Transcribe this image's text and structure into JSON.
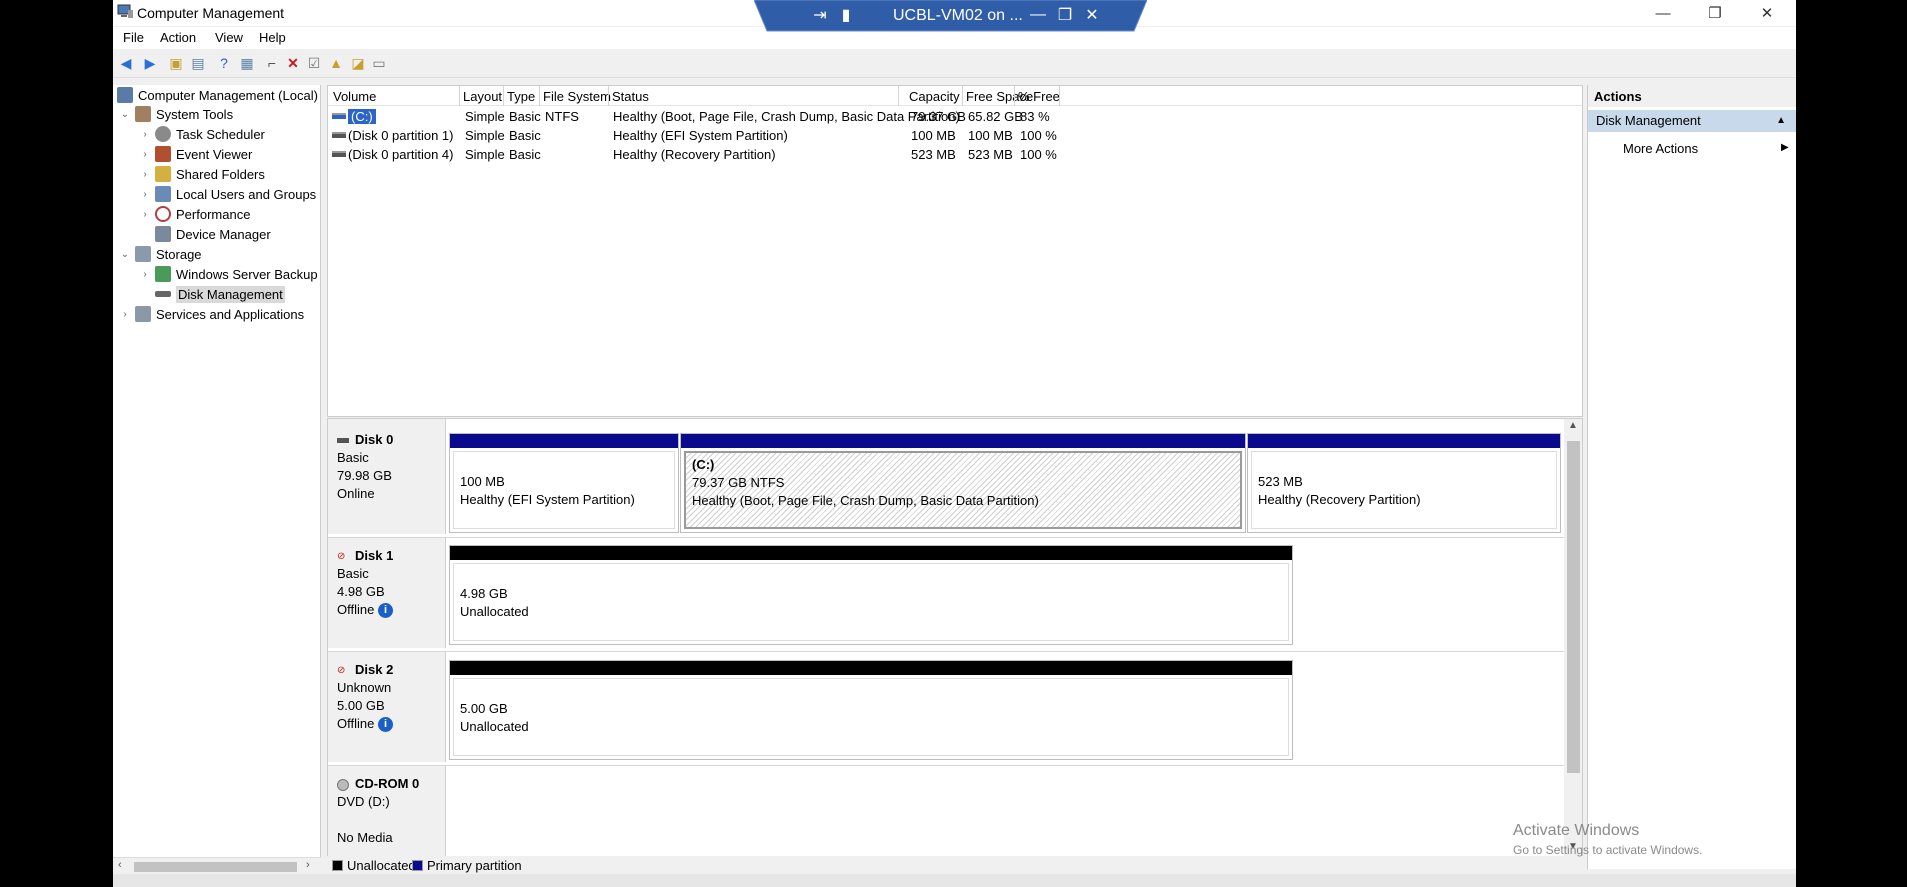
{
  "window": {
    "title": "Computer Management",
    "minimize": "—",
    "restore": "❐",
    "close": "✕"
  },
  "rdp": {
    "title": "UCBL-VM02 on ...",
    "pin_icon": "pin-icon",
    "signal_icon": "signal-icon"
  },
  "menu": [
    "File",
    "Action",
    "View",
    "Help"
  ],
  "tree": {
    "root": "Computer Management (Local)",
    "items": [
      {
        "label": "System Tools",
        "chev": "⌄"
      },
      {
        "label": "Task Scheduler",
        "chev": "›"
      },
      {
        "label": "Event Viewer",
        "chev": "›"
      },
      {
        "label": "Shared Folders",
        "chev": "›"
      },
      {
        "label": "Local Users and Groups",
        "chev": "›"
      },
      {
        "label": "Performance",
        "chev": "›"
      },
      {
        "label": "Device Manager",
        "chev": ""
      },
      {
        "label": "Storage",
        "chev": "⌄"
      },
      {
        "label": "Windows Server Backup",
        "chev": "›"
      },
      {
        "label": "Disk Management",
        "chev": ""
      },
      {
        "label": "Services and Applications",
        "chev": "›"
      }
    ]
  },
  "volumes": {
    "columns": [
      "Volume",
      "Layout",
      "Type",
      "File System",
      "Status",
      "Capacity",
      "Free Space",
      "% Free"
    ],
    "rows": [
      [
        "(C:)",
        "Simple",
        "Basic",
        "NTFS",
        "Healthy (Boot, Page File, Crash Dump, Basic Data Partition)",
        "79.37 GB",
        "65.82 GB",
        "83 %"
      ],
      [
        "(Disk 0 partition 1)",
        "Simple",
        "Basic",
        "",
        "Healthy (EFI System Partition)",
        "100 MB",
        "100 MB",
        "100 %"
      ],
      [
        "(Disk 0 partition 4)",
        "Simple",
        "Basic",
        "",
        "Healthy (Recovery Partition)",
        "523 MB",
        "523 MB",
        "100 %"
      ]
    ]
  },
  "disks": [
    {
      "name": "Disk 0",
      "type": "Basic",
      "size": "79.98 GB",
      "state": "Online",
      "partitions": [
        {
          "title": "",
          "size": "100 MB",
          "status": "Healthy (EFI System Partition)"
        },
        {
          "title": "(C:)",
          "size": "79.37 GB NTFS",
          "status": "Healthy (Boot, Page File, Crash Dump, Basic Data Partition)"
        },
        {
          "title": "",
          "size": "523 MB",
          "status": "Healthy (Recovery Partition)"
        }
      ]
    },
    {
      "name": "Disk 1",
      "type": "Basic",
      "size": "4.98 GB",
      "state": "Offline",
      "partitions": [
        {
          "size": "4.98 GB",
          "status": "Unallocated"
        }
      ]
    },
    {
      "name": "Disk 2",
      "type": "Unknown",
      "size": "5.00 GB",
      "state": "Offline",
      "partitions": [
        {
          "size": "5.00 GB",
          "status": "Unallocated"
        }
      ]
    },
    {
      "name": "CD-ROM 0",
      "type": "DVD (D:)",
      "size": "",
      "state": "No Media"
    }
  ],
  "legend": {
    "unallocated": "Unallocated",
    "primary": "Primary partition"
  },
  "actions": {
    "header": "Actions",
    "section": "Disk Management",
    "more": "More Actions"
  },
  "watermark": {
    "line1": "Activate Windows",
    "line2": "Go to Settings to activate Windows."
  },
  "colors": {
    "primary": "#0a0a8c",
    "unallocated": "#000000",
    "selection": "#2c64c8"
  }
}
